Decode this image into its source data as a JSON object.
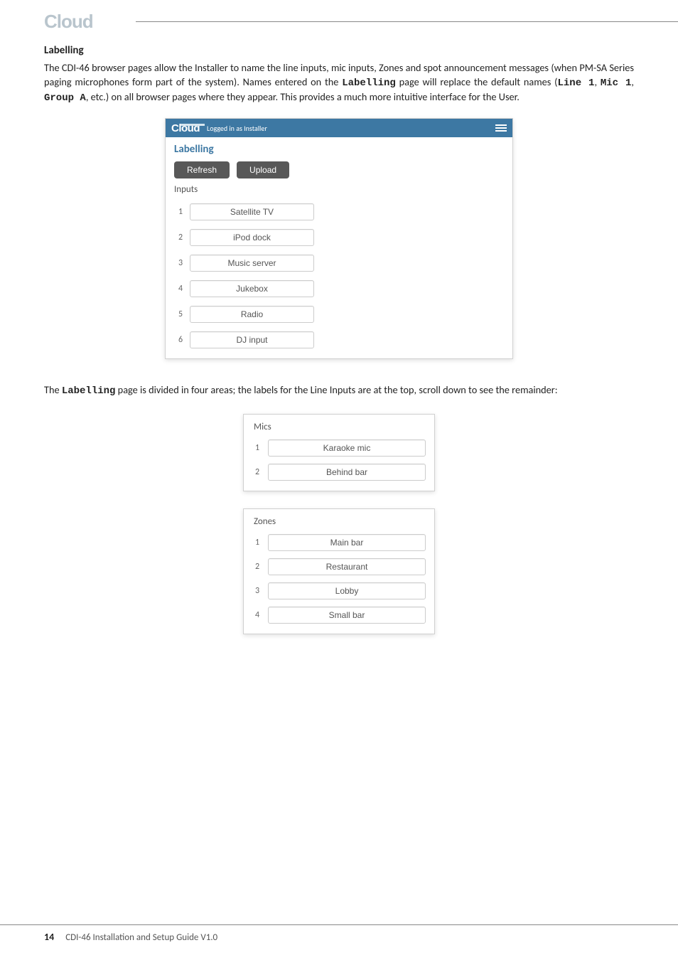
{
  "logo": "Cloud",
  "section_title": "Labelling",
  "intro_parts": {
    "t1": "The CDI-46 browser pages allow the Installer to name the line inputs, mic inputs, Zones and spot announcement messages (when PM-SA Series paging microphones form part of the system). Names entered on the ",
    "m1": "Labelling",
    "t2": " page will replace the default names (",
    "m2": "Line 1",
    "t3": ", ",
    "m3": "Mic 1",
    "t4": ", ",
    "m4": "Group A",
    "t5": ", etc.) on all browser pages where they appear. This provides a much more intuitive interface for the User."
  },
  "panel": {
    "logo": "Cloud",
    "login": "Logged in as Installer",
    "title": "Labelling",
    "refresh": "Refresh",
    "upload": "Upload",
    "inputs_head": "Inputs",
    "inputs": [
      {
        "n": "1",
        "v": "Satellite TV"
      },
      {
        "n": "2",
        "v": "iPod dock"
      },
      {
        "n": "3",
        "v": "Music server"
      },
      {
        "n": "4",
        "v": "Jukebox"
      },
      {
        "n": "5",
        "v": "Radio"
      },
      {
        "n": "6",
        "v": "DJ input"
      }
    ]
  },
  "mid_text_parts": {
    "t1": "The ",
    "m1": "Labelling",
    "t2": " page is divided in four areas; the labels for the Line Inputs are at the top, scroll down to see the remainder:"
  },
  "mics": {
    "head": "Mics",
    "rows": [
      {
        "n": "1",
        "v": "Karaoke mic"
      },
      {
        "n": "2",
        "v": "Behind bar"
      }
    ]
  },
  "zones": {
    "head": "Zones",
    "rows": [
      {
        "n": "1",
        "v": "Main bar"
      },
      {
        "n": "2",
        "v": "Restaurant"
      },
      {
        "n": "3",
        "v": "Lobby"
      },
      {
        "n": "4",
        "v": "Small bar"
      }
    ]
  },
  "footer": {
    "page": "14",
    "title": "CDI-46 Installation and Setup Guide V1.0"
  }
}
